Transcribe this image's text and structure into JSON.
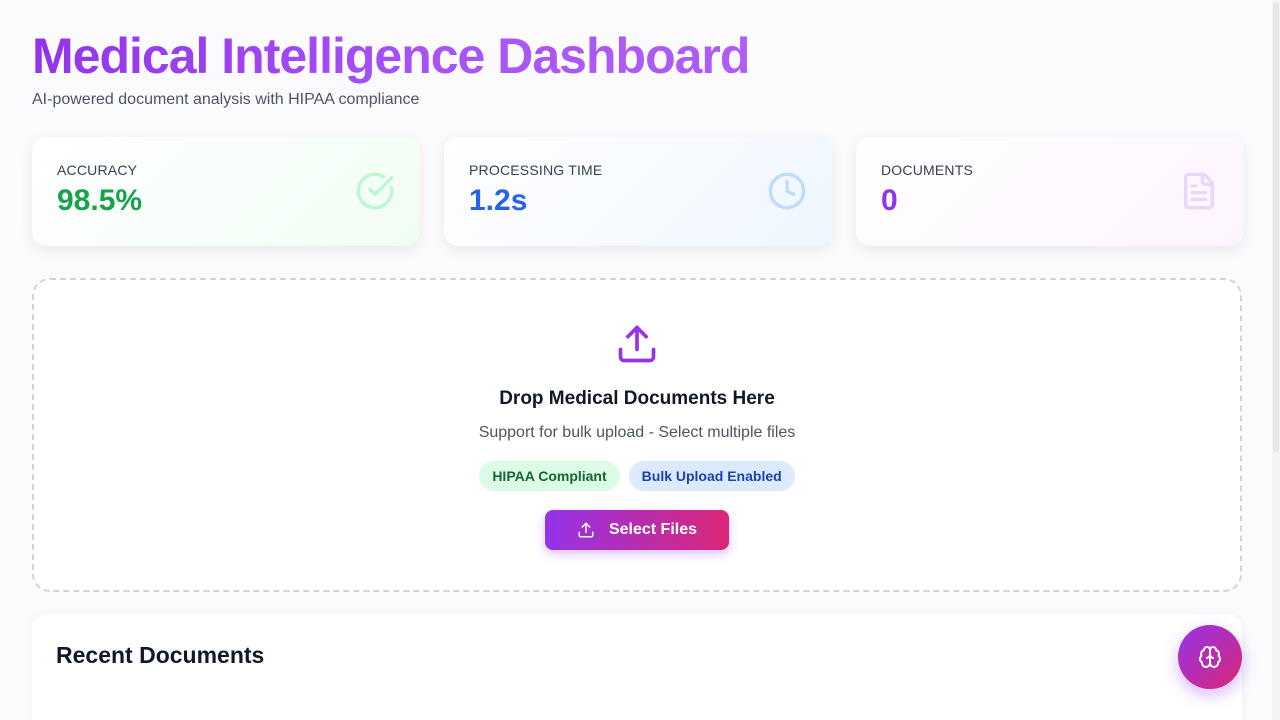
{
  "header": {
    "title": "Medical Intelligence Dashboard",
    "subtitle": "AI-powered document analysis with HIPAA compliance"
  },
  "stats": [
    {
      "label": "ACCURACY",
      "value": "98.5%",
      "icon": "check-circle-icon",
      "color": "#16a34a"
    },
    {
      "label": "PROCESSING TIME",
      "value": "1.2s",
      "icon": "clock-icon",
      "color": "#2563eb"
    },
    {
      "label": "DOCUMENTS",
      "value": "0",
      "icon": "document-icon",
      "color": "#9333ea"
    }
  ],
  "dropzone": {
    "icon": "upload-icon",
    "title": "Drop Medical Documents Here",
    "subtitle": "Support for bulk upload - Select multiple files",
    "badges": [
      "HIPAA Compliant",
      "Bulk Upload Enabled"
    ],
    "button_label": "Select Files"
  },
  "recent": {
    "title": "Recent Documents"
  },
  "fab": {
    "icon": "brain-icon"
  }
}
